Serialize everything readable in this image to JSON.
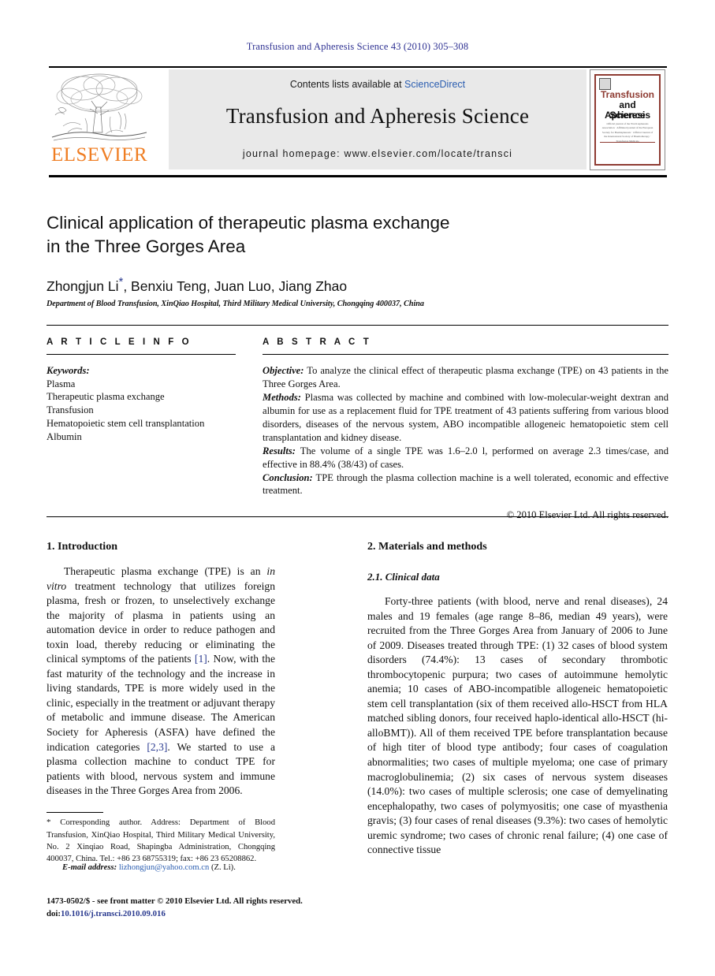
{
  "running_head": "Transfusion and Apheresis Science 43 (2010) 305–308",
  "masthead": {
    "publisher_logo_text": "ELSEVIER",
    "contents_prefix": "Contents lists available at ",
    "contents_link": "ScienceDirect",
    "journal_title": "Transfusion and Apheresis Science",
    "homepage": "journal homepage: www.elsevier.com/locate/transci",
    "cover": {
      "line1": "Transfusion",
      "line2": "and Apheresis",
      "line3": "Science",
      "blurb": "Official journal of the World Apheresis Association · Affiliated journal of the European Society for Haemapheresis · Official Journal of the International Society of Haemotherapy · Transfusion Médicale"
    }
  },
  "article": {
    "title_line1": "Clinical application of therapeutic plasma exchange",
    "title_line2": "in the Three Gorges Area",
    "authors": "Zhongjun Li",
    "authors_rest": ", Benxiu Teng, Juan Luo, Jiang Zhao",
    "corresponding_marker": "*",
    "affiliation": "Department of Blood Transfusion, XinQiao Hospital, Third Military Medical University, Chongqing 400037, China"
  },
  "article_info": {
    "heading": "A R T I C L E   I N F O",
    "keywords_label": "Keywords:",
    "keywords": [
      "Plasma",
      "Therapeutic plasma exchange",
      "Transfusion",
      "Hematopoietic stem cell transplantation",
      "Albumin"
    ]
  },
  "abstract": {
    "heading": "A B S T R A C T",
    "sections": [
      {
        "label": "Objective:",
        "text": " To analyze the clinical effect of therapeutic plasma exchange (TPE) on 43 patients in the Three Gorges Area."
      },
      {
        "label": "Methods:",
        "text": " Plasma was collected by machine and combined with low-molecular-weight dextran and albumin for use as a replacement fluid for TPE treatment of 43 patients suffering from various blood disorders, diseases of the nervous system, ABO incompatible allogeneic hematopoietic stem cell transplantation and kidney disease."
      },
      {
        "label": "Results:",
        "text": " The volume of a single TPE was 1.6–2.0 l, performed on average 2.3 times/case, and effective in 88.4% (38/43) of cases."
      },
      {
        "label": "Conclusion:",
        "text": " TPE through the plasma collection machine is a well tolerated, economic and effective treatment."
      }
    ],
    "copyright": "© 2010 Elsevier Ltd. All rights reserved."
  },
  "body": {
    "left": {
      "heading": "1. Introduction",
      "paragraph_parts": [
        "Therapeutic plasma exchange (TPE) is an ",
        "in vitro",
        " treatment technology that utilizes foreign plasma, fresh or frozen, to unselectively exchange the majority of plasma in patients using an automation device in order to reduce pathogen and toxin load, thereby reducing or eliminating the clinical symptoms of the patients ",
        "[1]",
        ". Now, with the fast maturity of the technology and the increase in living standards, TPE is more widely used in the clinic, especially in the treatment or adjuvant therapy of metabolic and immune disease. The American Society for Apheresis (ASFA) have defined the indication categories ",
        "[2,3]",
        ". We started to use a plasma collection machine to conduct TPE for patients with blood, nervous system and immune diseases in the Three Gorges Area from 2006."
      ]
    },
    "right": {
      "heading": "2. Materials and methods",
      "subheading": "2.1. Clinical data",
      "paragraph": "Forty-three patients (with blood, nerve and renal diseases), 24 males and 19 females (age range 8–86, median 49 years), were recruited from the Three Gorges Area from January of 2006 to June of 2009. Diseases treated through TPE: (1) 32 cases of blood system disorders (74.4%): 13 cases of secondary thrombotic thrombocytopenic purpura; two cases of autoimmune hemolytic anemia; 10 cases of ABO-incompatible allogeneic hematopoietic stem cell transplantation (six of them received allo-HSCT from HLA matched sibling donors, four received haplo-identical allo-HSCT (hi-alloBMT)). All of them received TPE before transplantation because of high titer of blood type antibody; four cases of coagulation abnormalities; two cases of multiple myeloma; one case of primary macroglobulinemia; (2) six cases of nervous system diseases (14.0%): two cases of multiple sclerosis; one case of demyelinating encephalopathy, two cases of polymyositis; one case of myasthenia gravis; (3) four cases of renal diseases (9.3%): two cases of hemolytic uremic syndrome; two cases of chronic renal failure; (4) one case of connective tissue"
    }
  },
  "footer": {
    "corresponding_note": " Corresponding author. Address: Department of Blood Transfusion, XinQiao Hospital, Third Military Medical University, No. 2 Xinqiao Road, Shapingba Administration, Chongqing 400037, China. Tel.: +86 23 68755319; fax: +86 23 65208862.",
    "email_label": "E-mail address:",
    "email": "lizhongjun@yahoo.com.cn",
    "email_suffix": " (Z. Li).",
    "issn_line": "1473-0502/$ - see front matter © 2010 Elsevier Ltd. All rights reserved.",
    "doi_label": "doi:",
    "doi_value": "10.1016/j.transci.2010.09.016"
  }
}
